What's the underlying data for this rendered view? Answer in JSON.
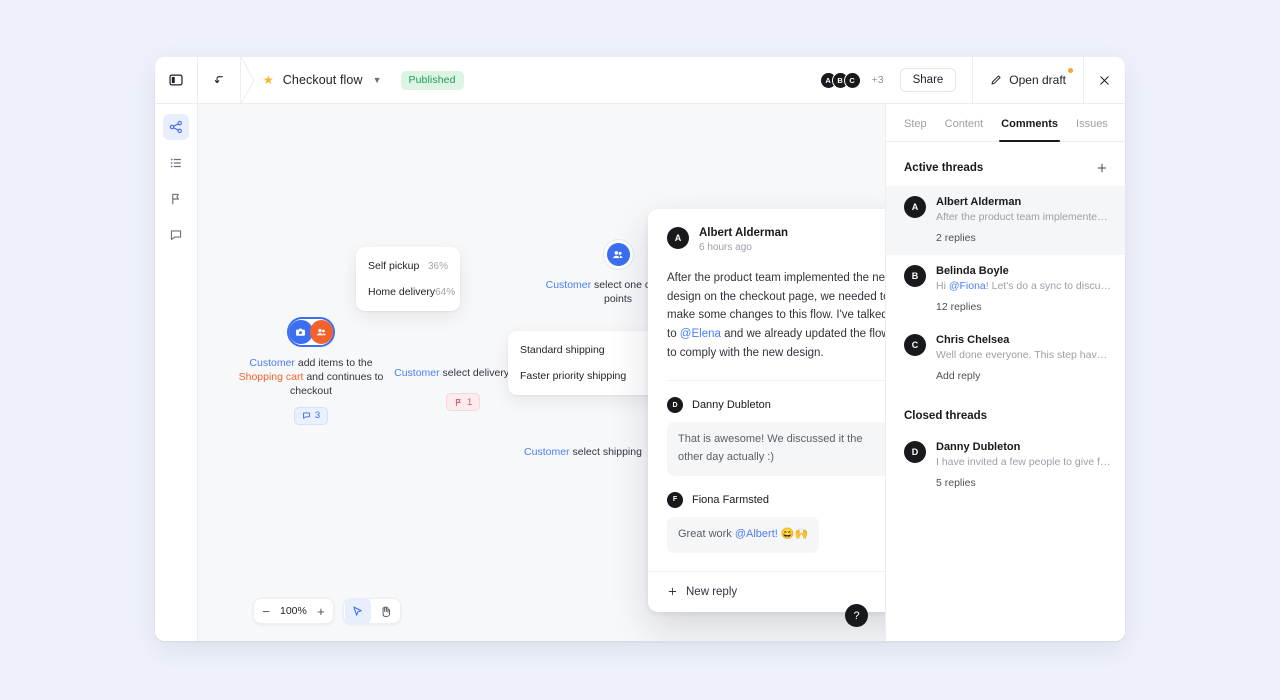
{
  "window": {
    "topbar": {
      "sidebar_toggle_icon": "panel-toggle-icon",
      "back_icon": "arrow-up-left-icon",
      "star_icon": "star-icon",
      "title": "Checkout flow",
      "title_chevron_icon": "chevron-down-icon",
      "status_badge": "Published",
      "avatars": [
        "A",
        "B",
        "C"
      ],
      "avatar_overflow": "+3",
      "share_label": "Share",
      "open_draft_label": "Open draft",
      "open_draft_icon": "pencil-icon",
      "close_icon": "close-icon"
    },
    "rail": [
      {
        "icon": "flow-share-icon",
        "name": "flow",
        "active": true
      },
      {
        "icon": "list-icon",
        "name": "list",
        "active": false
      },
      {
        "icon": "flag-icon",
        "name": "issues",
        "active": false
      },
      {
        "icon": "comment-icon",
        "name": "comments",
        "active": false
      }
    ]
  },
  "canvas": {
    "nodes": [
      {
        "id": "cart",
        "label_parts": [
          {
            "text": "Customer",
            "style": "customer"
          },
          {
            "text": " add items to the ",
            "style": "plain"
          },
          {
            "text": "Shopping cart",
            "style": "cart"
          },
          {
            "text": " and continues to checkout",
            "style": "plain"
          }
        ],
        "badge": {
          "type": "comments",
          "icon": "comment-icon",
          "count": "3"
        }
      },
      {
        "id": "delivery-type",
        "label_parts": [
          {
            "text": "Customer",
            "style": "customer"
          },
          {
            "text": " select delivery type",
            "style": "plain"
          }
        ],
        "badge": {
          "type": "issues",
          "icon": "flag-icon",
          "count": "1"
        }
      },
      {
        "id": "pickup-points",
        "label_parts": [
          {
            "text": "Customer",
            "style": "customer"
          },
          {
            "text": " select one of pickup-points",
            "style": "plain"
          }
        ]
      },
      {
        "id": "shipping",
        "label_parts": [
          {
            "text": "Customer",
            "style": "customer"
          },
          {
            "text": " select shipping",
            "style": "plain"
          }
        ]
      }
    ],
    "split_delivery": {
      "rows": [
        {
          "label": "Self pickup",
          "pct": "36%"
        },
        {
          "label": "Home delivery",
          "pct": "64%"
        }
      ]
    },
    "split_shipping": {
      "rows": [
        {
          "label": "Standard shipping",
          "pct": ""
        },
        {
          "label": "Faster priority shipping",
          "pct": ""
        }
      ]
    },
    "controls": {
      "zoom_out": "−",
      "zoom_level": "100%",
      "zoom_in": "+",
      "cursor_tool_icon": "cursor-icon",
      "hand_tool_icon": "hand-icon",
      "help_label": "?"
    }
  },
  "popup": {
    "author": "Albert Alderman",
    "author_initial": "A",
    "time": "6 hours ago",
    "body_parts": [
      {
        "text": "After the product team implemented the new design on the checkout page, we needed to make some changes to this flow. I've talked to ",
        "style": "plain"
      },
      {
        "text": "@Elena",
        "style": "mention"
      },
      {
        "text": " and we already updated the flow to comply with the new design.",
        "style": "plain"
      }
    ],
    "replies": [
      {
        "initial": "D",
        "name": "Danny Dubleton",
        "text_parts": [
          {
            "text": "That is awesome! We discussed it the other day actually :)",
            "style": "plain"
          }
        ]
      },
      {
        "initial": "F",
        "name": "Fiona Farmsted",
        "text_parts": [
          {
            "text": "Great work ",
            "style": "plain"
          },
          {
            "text": "@Albert!",
            "style": "mention"
          },
          {
            "text": " 😄🙌",
            "style": "plain"
          }
        ]
      }
    ],
    "new_reply_label": "New reply",
    "new_reply_icon": "plus-icon"
  },
  "panel": {
    "tabs": [
      {
        "label": "Step",
        "active": false
      },
      {
        "label": "Content",
        "active": false
      },
      {
        "label": "Comments",
        "active": true
      },
      {
        "label": "Issues",
        "active": false
      }
    ],
    "active_section": {
      "title": "Active threads",
      "add_icon": "plus-icon",
      "threads": [
        {
          "initial": "A",
          "name": "Albert Alderman",
          "preview_parts": [
            {
              "text": "After the product team implemented th...",
              "style": "plain"
            }
          ],
          "meta": "2 replies",
          "selected": true
        },
        {
          "initial": "B",
          "name": "Belinda Boyle",
          "preview_parts": [
            {
              "text": "Hi ",
              "style": "plain"
            },
            {
              "text": "@Fiona",
              "style": "mention"
            },
            {
              "text": "! Let's do a sync to discuss the n...",
              "style": "plain"
            }
          ],
          "meta": "12 replies",
          "selected": false
        },
        {
          "initial": "C",
          "name": "Chris Chelsea",
          "preview_parts": [
            {
              "text": "Well done everyone. This step have creat...",
              "style": "plain"
            }
          ],
          "meta": "Add reply",
          "selected": false
        }
      ]
    },
    "closed_section": {
      "title": "Closed threads",
      "threads": [
        {
          "initial": "D",
          "name": "Danny Dubleton",
          "preview_parts": [
            {
              "text": "I have invited a few people to give feedback...",
              "style": "plain"
            }
          ],
          "meta": "5 replies",
          "selected": false
        }
      ]
    }
  },
  "colors": {
    "accent_blue": "#3b6ef0",
    "accent_orange": "#f2622a",
    "published_green": "#1f9d55",
    "issue_red": "#e0516b"
  }
}
